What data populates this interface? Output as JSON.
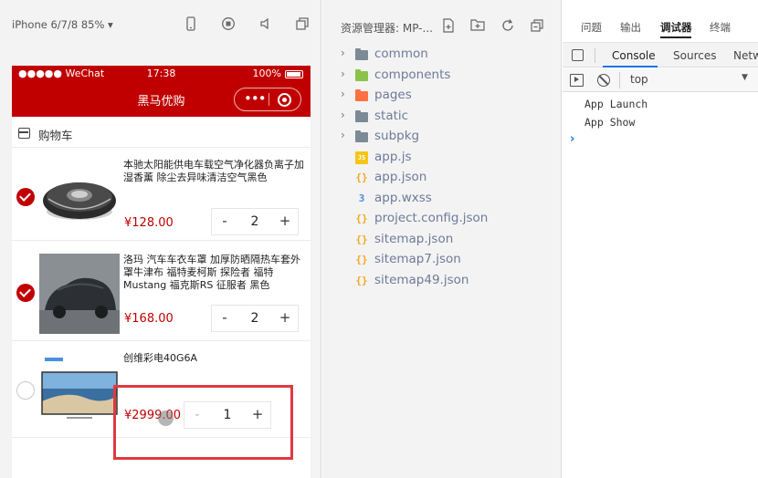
{
  "simulator": {
    "device_label": "iPhone 6/7/8 85% ▾",
    "toolbar_icons": [
      "phone-icon",
      "record-icon",
      "volume-icon",
      "multi-window-icon"
    ],
    "status_bar": {
      "carrier": "●●●●● WeChat",
      "time": "17:38",
      "battery": "100%"
    },
    "nav_title": "黑马优购",
    "capsule_dots": "•••",
    "accent": "#c00000"
  },
  "cart": {
    "title": "购物车",
    "items": [
      {
        "title": "本驰太阳能供电车载空气净化器负离子加湿香薰 除尘去异味清洁空气黑色",
        "price": "¥128.00",
        "quantity": "2",
        "checked": true
      },
      {
        "title": "洛玛 汽车车衣车罩 加厚防晒隔热车套外罩牛津布 福特麦柯斯 探险者 福特Mustang 福克斯RS 征服者 黑色",
        "price": "¥168.00",
        "quantity": "2",
        "checked": true
      },
      {
        "title": "创维彩电40G6A",
        "price": "¥2999.00",
        "quantity": "1",
        "checked": false
      }
    ],
    "minus": "-",
    "plus": "+"
  },
  "explorer": {
    "title": "资源管理器: MP-...",
    "tree": [
      {
        "label": "common",
        "kind": "folder",
        "color": "#7c8a96"
      },
      {
        "label": "components",
        "kind": "folder",
        "color": "#8bc34a"
      },
      {
        "label": "pages",
        "kind": "folder",
        "color": "#ff7043"
      },
      {
        "label": "static",
        "kind": "folder",
        "color": "#7c8a96"
      },
      {
        "label": "subpkg",
        "kind": "folder",
        "color": "#7c8a96"
      },
      {
        "label": "app.js",
        "kind": "js",
        "glyph": "JS",
        "color": "#f5c518"
      },
      {
        "label": "app.json",
        "kind": "json",
        "glyph": "{}",
        "color": "#f5a623"
      },
      {
        "label": "app.wxss",
        "kind": "wxss",
        "glyph": "3",
        "color": "#4a90e2"
      },
      {
        "label": "project.config.json",
        "kind": "json",
        "glyph": "{}",
        "color": "#f5a623"
      },
      {
        "label": "sitemap.json",
        "kind": "json",
        "glyph": "{}",
        "color": "#f5a623"
      },
      {
        "label": "sitemap7.json",
        "kind": "json",
        "glyph": "{}",
        "color": "#f5a623"
      },
      {
        "label": "sitemap49.json",
        "kind": "json",
        "glyph": "{}",
        "color": "#f5a623"
      }
    ]
  },
  "devtools": {
    "tabs": [
      "问题",
      "输出",
      "调试器",
      "终端"
    ],
    "active_tab": "调试器",
    "console_tabs": [
      "Console",
      "Sources",
      "Netw"
    ],
    "context": "top",
    "logs": [
      "App  Launch",
      "App  Show"
    ],
    "prompt": "›"
  }
}
